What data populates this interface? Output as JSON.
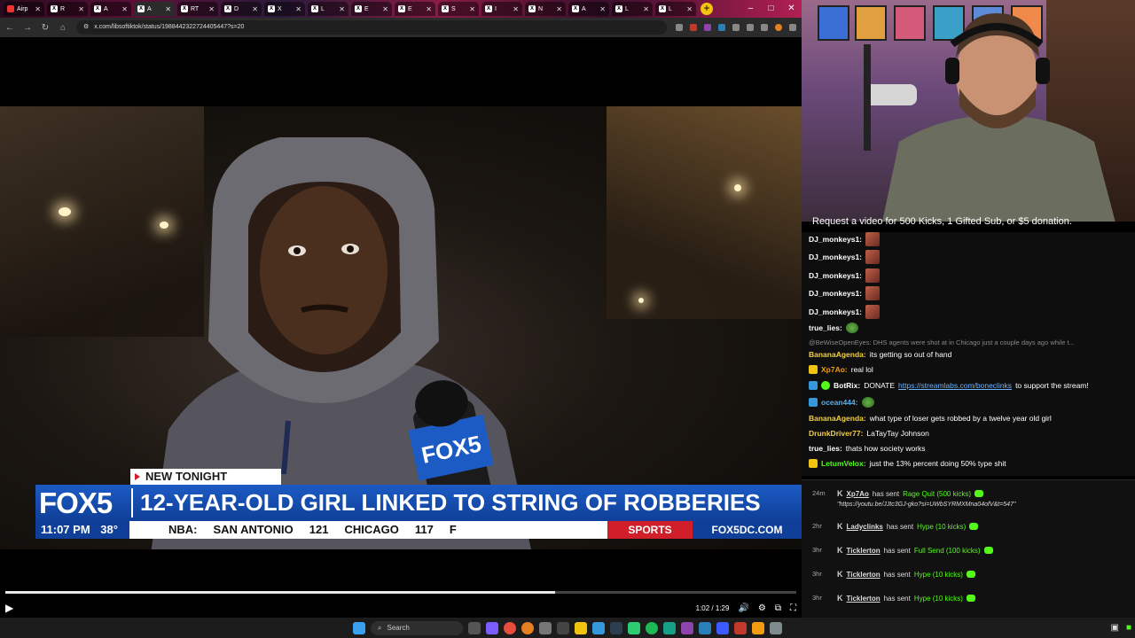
{
  "browser": {
    "tabs": [
      {
        "label": "Airp",
        "fav": "",
        "red": true
      },
      {
        "label": "R",
        "fav": "X"
      },
      {
        "label": "A",
        "fav": "X"
      },
      {
        "label": "A",
        "fav": "X",
        "active": true
      },
      {
        "label": "RT",
        "fav": "X"
      },
      {
        "label": "D",
        "fav": "X"
      },
      {
        "label": "X",
        "fav": "X"
      },
      {
        "label": "L",
        "fav": "X"
      },
      {
        "label": "E",
        "fav": "X"
      },
      {
        "label": "E",
        "fav": "X"
      },
      {
        "label": "S",
        "fav": "X"
      },
      {
        "label": "I",
        "fav": "X"
      },
      {
        "label": "N",
        "fav": "X"
      },
      {
        "label": "A",
        "fav": "X"
      },
      {
        "label": "L",
        "fav": "X"
      },
      {
        "label": "L",
        "fav": "X"
      }
    ],
    "new_tab_label": "+",
    "window_controls": [
      "–",
      "□",
      "✕"
    ],
    "url": "x.com/libsoftiktok/status/1988442322724405447?s=20"
  },
  "video": {
    "new_tonight": "NEW TONIGHT",
    "logo": "FOX5",
    "mic_flag": "FOX5",
    "headline": "12-YEAR-OLD GIRL LINKED TO STRING OF ROBBERIES",
    "time": "11:07 PM",
    "temp": "38°",
    "ticker": [
      "NBA:",
      "SAN ANTONIO",
      "121",
      "CHICAGO",
      "117",
      "F"
    ],
    "sports": "SPORTS",
    "site": "FOX5DC.COM",
    "progress_fraction": 0.695,
    "time_display": "1:02 / 1:29"
  },
  "taskbar": {
    "search_placeholder": "Search"
  },
  "stream": {
    "request_text": "Request a video for 500 Kicks, 1 Gifted Sub, or $5 donation."
  },
  "chat": {
    "messages": [
      {
        "user": "DJ_monkeys1:",
        "color": "#fff",
        "text": "",
        "emote": true
      },
      {
        "user": "DJ_monkeys1:",
        "color": "#fff",
        "text": "",
        "emote": true
      },
      {
        "user": "DJ_monkeys1:",
        "color": "#fff",
        "text": "",
        "emote": true
      },
      {
        "user": "DJ_monkeys1:",
        "color": "#fff",
        "text": "",
        "emote": true
      },
      {
        "user": "DJ_monkeys1:",
        "color": "#fff",
        "text": "",
        "emote": true
      },
      {
        "user": "true_lies:",
        "color": "#fff",
        "text": "",
        "pepe": true
      },
      {
        "reply": "@BeWiseOpenEyes: DHS agents were shot at in Chicago just a couple days ago while t..."
      },
      {
        "user": "BananaAgenda:",
        "color": "#f4d03f",
        "text": "its getting so out of hand"
      },
      {
        "user": "Xp7Ao:",
        "color": "#f39c12",
        "text": "real lol",
        "badge": "#f1c40f"
      },
      {
        "user": "BotRix:",
        "color": "#fff",
        "text": "DONATE",
        "link": "https://streamlabs.com/boneclinks",
        "tail": "to support the stream!",
        "badge": "#3498db",
        "badge2": "#53fc18"
      },
      {
        "user": "ocean444:",
        "color": "#5dade2",
        "text": "",
        "pepe": true,
        "badge": "#3498db"
      },
      {
        "user": "BananaAgenda:",
        "color": "#f4d03f",
        "text": "what type of loser gets robbed by a twelve year old girl"
      },
      {
        "user": "DrunkDriver77:",
        "color": "#f4d03f",
        "text": "LaTayTay Johnson"
      },
      {
        "user": "true_lies:",
        "color": "#fff",
        "text": "thats how society works"
      },
      {
        "user": "LetumVelox:",
        "color": "#53fc18",
        "text": "just the 13% percent doing 50% type shit",
        "badge": "#f1c40f"
      }
    ]
  },
  "events": [
    {
      "age": "24m",
      "name": "Xp7Ao",
      "sent": "has sent",
      "item": "Rage Quit (500 kicks)",
      "note": "\"https://youtu.be/JJtc3GJ-gko?si=UWbSYRMXMna04ofV&t=547\""
    },
    {
      "age": "2hr",
      "name": "Ladyclinks",
      "sent": "has sent",
      "item": "Hype (10 kicks)"
    },
    {
      "age": "3hr",
      "name": "Ticklerton",
      "sent": "has sent",
      "item": "Full Send (100 kicks)"
    },
    {
      "age": "3hr",
      "name": "Ticklerton",
      "sent": "has sent",
      "item": "Hype (10 kicks)"
    },
    {
      "age": "3hr",
      "name": "Ticklerton",
      "sent": "has sent",
      "item": "Hype (10 kicks)"
    },
    {
      "age": "3hr",
      "name": "Ticklerton",
      "sent": "has sent",
      "item": "Hype (10 kicks)"
    },
    {
      "age": "3hr",
      "name": "Ticklerton",
      "sent": "has sent",
      "item": "Hype (10 kicks)"
    }
  ],
  "colors": {
    "kick_green": "#53fc18",
    "fox_blue": "#0f3f98",
    "fox_red": "#d01f2a"
  }
}
